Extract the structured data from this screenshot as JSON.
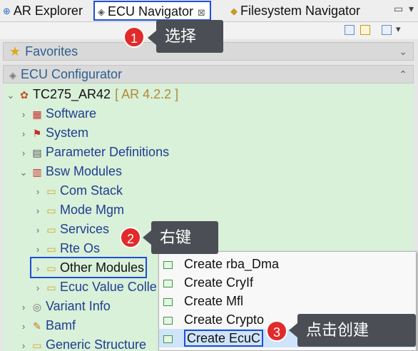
{
  "tabs": [
    {
      "label": "AR Explorer",
      "icon": "ar-explorer-icon"
    },
    {
      "label": "ECU Navigator",
      "icon": "ecu-navigator-icon",
      "close": "⊠"
    },
    {
      "label": "Filesystem Navigator",
      "icon": "filesystem-icon"
    }
  ],
  "panels": {
    "favorites": "Favorites",
    "ecu_configurator": "ECU Configurator"
  },
  "tree": {
    "root": {
      "label": "TC275_AR42",
      "sub": "[ AR 4.2.2 ]"
    },
    "items": [
      {
        "label": "Software"
      },
      {
        "label": "System"
      },
      {
        "label": "Parameter Definitions"
      },
      {
        "label": "Bsw Modules"
      },
      {
        "label": "Com Stack"
      },
      {
        "label": "Mode Mgm"
      },
      {
        "label": "Services"
      },
      {
        "label": "Rte Os"
      },
      {
        "label": "Other Modules"
      },
      {
        "label": "Ecuc Value Colle"
      },
      {
        "label": "Variant Info"
      },
      {
        "label": "Bamf"
      },
      {
        "label": "Generic Structure"
      }
    ]
  },
  "context_menu": [
    "Create rba_Dma",
    "Create CryIf",
    "Create Mfl",
    "Create Crypto",
    "Create EcuC"
  ],
  "callouts": [
    {
      "num": "1",
      "text": "选择"
    },
    {
      "num": "2",
      "text": "右键"
    },
    {
      "num": "3",
      "text": "点击创建"
    }
  ],
  "colors": {
    "accent": "#1f4fd6",
    "tree_bg": "#d9f0d9",
    "badge": "#e22a2a",
    "callout_bg": "#4b4f55"
  }
}
